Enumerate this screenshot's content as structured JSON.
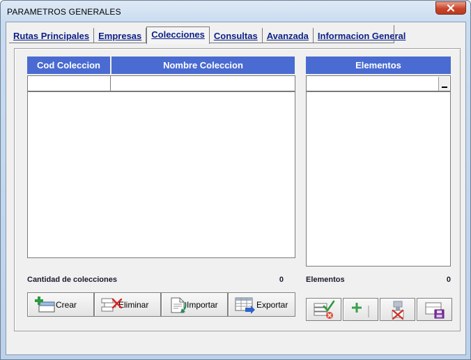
{
  "window": {
    "title": "PARAMETROS GENERALES",
    "close_icon": "close-x-icon",
    "close_color": "#c9452b"
  },
  "tabs": [
    {
      "label": "Rutas Principales",
      "active": false
    },
    {
      "label": "Empresas",
      "active": false
    },
    {
      "label": "Colecciones",
      "active": true
    },
    {
      "label": "Consultas",
      "active": false
    },
    {
      "label": "Avanzada",
      "active": false
    },
    {
      "label": "Informacion General",
      "active": false
    }
  ],
  "collections": {
    "columns": [
      "Cod Coleccion",
      "Nombre Coleccion"
    ],
    "new_row": {
      "cod": "",
      "nombre": ""
    },
    "rows": [],
    "count_label": "Cantidad de colecciones",
    "count_value": "0",
    "header_color": "#4a6bd1"
  },
  "elements": {
    "header": "Elementos",
    "selected_value": "",
    "items": [],
    "count_label": "Elementos",
    "count_value": "0"
  },
  "buttons": {
    "crear": {
      "label": "Crear",
      "icon": "add-table-icon"
    },
    "eliminar": {
      "label": "Eliminar",
      "icon": "delete-table-icon"
    },
    "importar": {
      "label": "Importar",
      "icon": "import-document-icon"
    },
    "exportar": {
      "label": "Exportar",
      "icon": "export-table-icon"
    },
    "check_elements": {
      "icon": "check-list-icon"
    },
    "add_element": {
      "icon": "plus-icon"
    },
    "remove_element": {
      "icon": "remove-element-icon"
    },
    "save_elements": {
      "icon": "save-icon"
    }
  }
}
